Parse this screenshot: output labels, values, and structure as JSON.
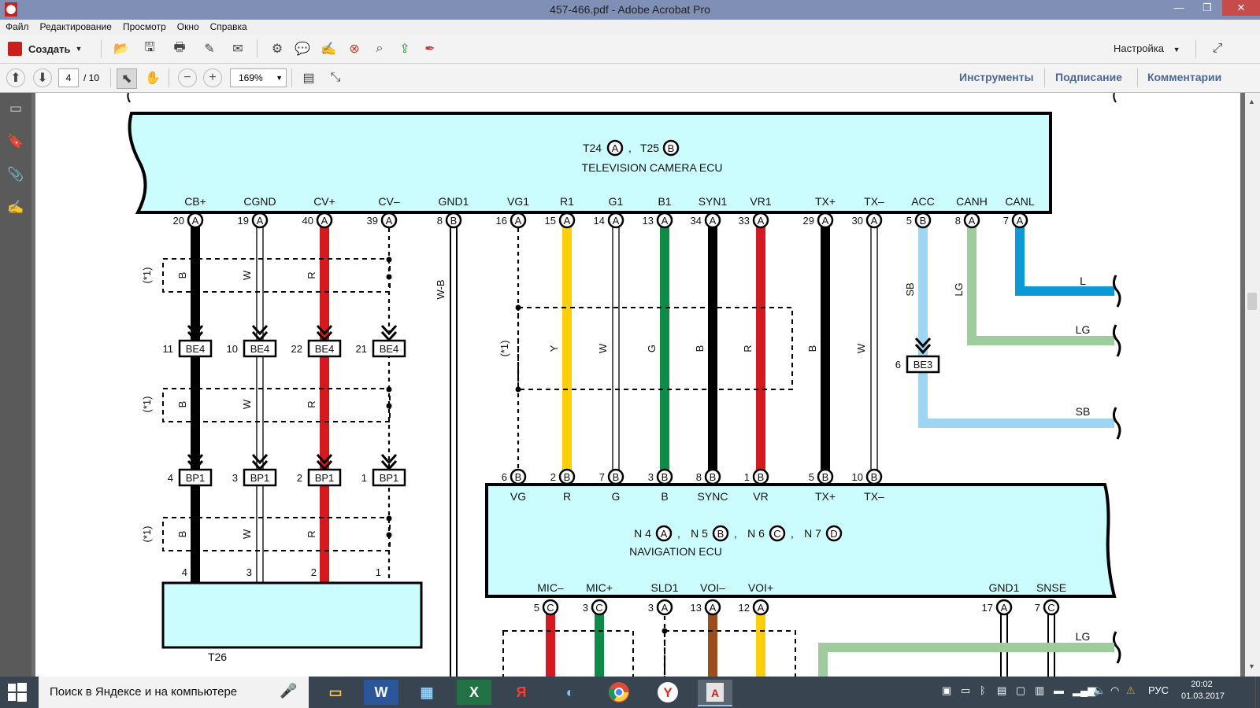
{
  "window": {
    "title": "457-466.pdf - Adobe Acrobat Pro",
    "app_icon": "acrobat-icon"
  },
  "menu": [
    "Файл",
    "Редактирование",
    "Просмотр",
    "Окно",
    "Справка"
  ],
  "toolbar": {
    "create_label": "Создать",
    "customize_label": "Настройка"
  },
  "nav": {
    "page_current": "4",
    "page_total": "/ 10",
    "zoom": "169%"
  },
  "panels": {
    "tools": "Инструменты",
    "sign": "Подписание",
    "comments": "Комментарии"
  },
  "taskbar": {
    "search_placeholder": "Поиск в Яндексе и на компьютере",
    "lang": "РУС",
    "time": "20:02",
    "date": "01.03.2017"
  },
  "diagram": {
    "tv_ecu": {
      "connectors": "T24 A , T25 B",
      "name": "TELEVISION CAMERA ECU"
    },
    "nav_ecu": {
      "connectors": "N 4 A , N 5 B , N 6 C , N 7 D",
      "name": "NAVIGATION ECU"
    },
    "t26_label": "T26",
    "tv_pins": [
      {
        "label": "CB+",
        "num": "20",
        "conn": "A"
      },
      {
        "label": "CGND",
        "num": "19",
        "conn": "A"
      },
      {
        "label": "CV+",
        "num": "40",
        "conn": "A"
      },
      {
        "label": "CV–",
        "num": "39",
        "conn": "A"
      },
      {
        "label": "GND1",
        "num": "8",
        "conn": "B"
      },
      {
        "label": "VG1",
        "num": "16",
        "conn": "A"
      },
      {
        "label": "R1",
        "num": "15",
        "conn": "A"
      },
      {
        "label": "G1",
        "num": "14",
        "conn": "A"
      },
      {
        "label": "B1",
        "num": "13",
        "conn": "A"
      },
      {
        "label": "SYN1",
        "num": "34",
        "conn": "A"
      },
      {
        "label": "VR1",
        "num": "33",
        "conn": "A"
      },
      {
        "label": "TX+",
        "num": "29",
        "conn": "A"
      },
      {
        "label": "TX–",
        "num": "30",
        "conn": "A"
      },
      {
        "label": "ACC",
        "num": "5",
        "conn": "B"
      },
      {
        "label": "CANH",
        "num": "8",
        "conn": "A"
      },
      {
        "label": "CANL",
        "num": "7",
        "conn": "A"
      }
    ],
    "nav_top_pins": [
      {
        "label": "VG",
        "num": "6",
        "conn": "B"
      },
      {
        "label": "R",
        "num": "2",
        "conn": "B"
      },
      {
        "label": "G",
        "num": "7",
        "conn": "B"
      },
      {
        "label": "B",
        "num": "3",
        "conn": "B"
      },
      {
        "label": "SYNC",
        "num": "8",
        "conn": "B"
      },
      {
        "label": "VR",
        "num": "1",
        "conn": "B"
      },
      {
        "label": "TX+",
        "num": "5",
        "conn": "B"
      },
      {
        "label": "TX–",
        "num": "10",
        "conn": "B"
      }
    ],
    "nav_bottom_pins": [
      {
        "label": "MIC–",
        "num": "5",
        "conn": "C"
      },
      {
        "label": "MIC+",
        "num": "3",
        "conn": "C"
      },
      {
        "label": "SLD1",
        "num": "3",
        "conn": "A"
      },
      {
        "label": "VOI–",
        "num": "13",
        "conn": "A"
      },
      {
        "label": "VOI+",
        "num": "12",
        "conn": "A"
      },
      {
        "label": "GND1",
        "num": "17",
        "conn": "A"
      },
      {
        "label": "SNSE",
        "num": "7",
        "conn": "C"
      }
    ],
    "be4": [
      {
        "num": "11",
        "name": "BE4"
      },
      {
        "num": "10",
        "name": "BE4"
      },
      {
        "num": "22",
        "name": "BE4"
      },
      {
        "num": "21",
        "name": "BE4"
      }
    ],
    "bp1": [
      {
        "num": "4",
        "name": "BP1"
      },
      {
        "num": "3",
        "name": "BP1"
      },
      {
        "num": "2",
        "name": "BP1"
      },
      {
        "num": "1",
        "name": "BP1"
      }
    ],
    "t26_pins": [
      "4",
      "3",
      "2",
      "1"
    ],
    "be3": {
      "num": "6",
      "name": "BE3"
    },
    "left_wire_colors": [
      "B",
      "W",
      "R"
    ],
    "mid_wire_colors": [
      "Y",
      "W",
      "G",
      "B",
      "R"
    ],
    "tx_wire_colors": [
      "B",
      "W"
    ],
    "right_wire_colors": [
      "SB",
      "LG"
    ],
    "shield_note": "(*1)",
    "wb": "W-B",
    "right_labels": [
      "L",
      "LG",
      "SB",
      "LG"
    ],
    "colors": {
      "ecu_fill": "#ccfdfe",
      "black": "#000000",
      "red": "#d5191e",
      "yellow": "#fdcf06",
      "green": "#0c8c46",
      "sky": "#9dd5f2",
      "blue": "#0b9ad8",
      "lightgreen": "#9fcc9c",
      "brown": "#9d4d1b"
    }
  }
}
